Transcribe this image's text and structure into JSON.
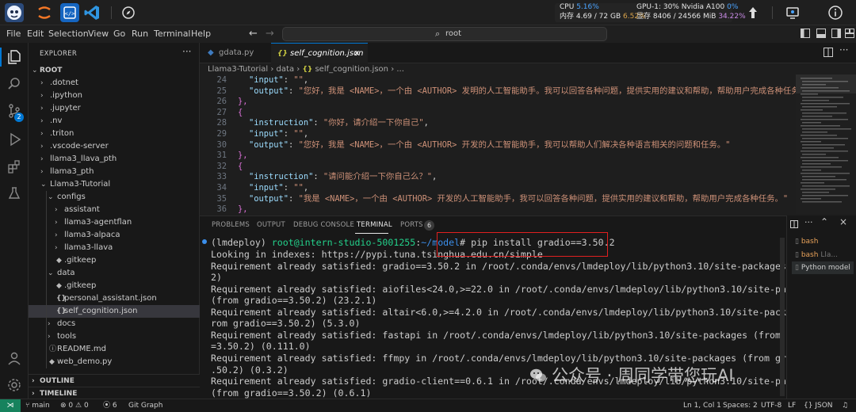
{
  "system_stats": {
    "cpu_label": "CPU",
    "cpu_value": "5.16%",
    "mem_line": "内存 4.69 / 72 GB",
    "mem_pct": "6.52%",
    "gpu_label": "GPU-1: 30% Nvidia A100",
    "gpu_pct": "0%",
    "vram_line": "显存 8406 / 24566 MiB",
    "vram_pct": "34.22%"
  },
  "menu": [
    "File",
    "Edit",
    "Selection",
    "View",
    "Go",
    "Run",
    "Terminal",
    "Help"
  ],
  "command_center": {
    "text": "root"
  },
  "explorer": {
    "title": "EXPLORER",
    "root": "ROOT",
    "items": [
      {
        "label": ".dotnet",
        "depth": 1,
        "kind": "folder",
        "open": false
      },
      {
        "label": ".ipython",
        "depth": 1,
        "kind": "folder",
        "open": false
      },
      {
        "label": ".jupyter",
        "depth": 1,
        "kind": "folder",
        "open": false
      },
      {
        "label": ".nv",
        "depth": 1,
        "kind": "folder",
        "open": false
      },
      {
        "label": ".triton",
        "depth": 1,
        "kind": "folder",
        "open": false
      },
      {
        "label": ".vscode-server",
        "depth": 1,
        "kind": "folder",
        "open": false
      },
      {
        "label": "llama3_llava_pth",
        "depth": 1,
        "kind": "folder",
        "open": false
      },
      {
        "label": "llama3_pth",
        "depth": 1,
        "kind": "folder",
        "open": false
      },
      {
        "label": "Llama3-Tutorial",
        "depth": 1,
        "kind": "folder",
        "open": true
      },
      {
        "label": "configs",
        "depth": 2,
        "kind": "folder",
        "open": true
      },
      {
        "label": "assistant",
        "depth": 3,
        "kind": "folder",
        "open": false
      },
      {
        "label": "llama3-agentflan",
        "depth": 3,
        "kind": "folder",
        "open": false
      },
      {
        "label": "llama3-alpaca",
        "depth": 3,
        "kind": "folder",
        "open": false
      },
      {
        "label": "llama3-llava",
        "depth": 3,
        "kind": "folder",
        "open": false
      },
      {
        "label": ".gitkeep",
        "depth": 3,
        "kind": "git",
        "open": false
      },
      {
        "label": "data",
        "depth": 2,
        "kind": "folder",
        "open": true
      },
      {
        "label": ".gitkeep",
        "depth": 3,
        "kind": "git",
        "open": false
      },
      {
        "label": "personal_assistant.json",
        "depth": 3,
        "kind": "json",
        "open": false
      },
      {
        "label": "self_cognition.json",
        "depth": 3,
        "kind": "json",
        "open": false,
        "selected": true
      },
      {
        "label": "docs",
        "depth": 2,
        "kind": "folder",
        "open": false
      },
      {
        "label": "tools",
        "depth": 2,
        "kind": "folder",
        "open": false
      },
      {
        "label": "README.md",
        "depth": 2,
        "kind": "md",
        "open": false
      },
      {
        "label": "web_demo.py",
        "depth": 2,
        "kind": "py",
        "open": false
      }
    ],
    "outline": "OUTLINE",
    "timeline": "TIMELINE"
  },
  "tabs": [
    {
      "label": "gdata.py",
      "icon": "py"
    },
    {
      "label": "self_cognition.json",
      "icon": "json",
      "active": true
    }
  ],
  "breadcrumb": [
    "Llama3-Tutorial",
    "data",
    "self_cognition.json",
    "..."
  ],
  "code_lines": [
    {
      "num": "24",
      "indent": 2,
      "key": "\"input\"",
      "sep": ": ",
      "val": "\"\"",
      "end": ","
    },
    {
      "num": "25",
      "indent": 2,
      "key": "\"output\"",
      "sep": ": ",
      "val": "\"您好，我是 <NAME>，一个由 <AUTHOR> 发明的人工智能助手。我可以回答各种问题，提供实用的建议和帮助，帮助用户完成各种任务",
      "end": ""
    },
    {
      "num": "26",
      "indent": 1,
      "brace": "},",
      "brace_class": "b1"
    },
    {
      "num": "27",
      "indent": 1,
      "brace": "{",
      "brace_class": "b1"
    },
    {
      "num": "28",
      "indent": 2,
      "key": "\"instruction\"",
      "sep": ": ",
      "val": "\"你好，请介绍一下你自己\"",
      "end": ","
    },
    {
      "num": "29",
      "indent": 2,
      "key": "\"input\"",
      "sep": ": ",
      "val": "\"\"",
      "end": ","
    },
    {
      "num": "30",
      "indent": 2,
      "key": "\"output\"",
      "sep": ": ",
      "val": "\"您好，我是 <NAME>，一个由 <AUTHOR> 开发的人工智能助手，我可以帮助人们解决各种语言相关的问题和任务。\"",
      "end": ""
    },
    {
      "num": "31",
      "indent": 1,
      "brace": "},",
      "brace_class": "b1"
    },
    {
      "num": "32",
      "indent": 1,
      "brace": "{",
      "brace_class": "b1"
    },
    {
      "num": "33",
      "indent": 2,
      "key": "\"instruction\"",
      "sep": ": ",
      "val": "\"请问能介绍一下你自己么？\"",
      "end": ","
    },
    {
      "num": "34",
      "indent": 2,
      "key": "\"input\"",
      "sep": ": ",
      "val": "\"\"",
      "end": ","
    },
    {
      "num": "35",
      "indent": 2,
      "key": "\"output\"",
      "sep": ": ",
      "val": "\"我是 <NAME>，一个由 <AUTHOR> 开发的人工智能助手，我可以回答各种问题，提供实用的建议和帮助，帮助用户完成各种任务。\"",
      "end": ""
    },
    {
      "num": "36",
      "indent": 1,
      "brace": "},",
      "brace_class": "b1"
    }
  ],
  "panel_tabs": [
    "PROBLEMS",
    "OUTPUT",
    "DEBUG CONSOLE",
    "TERMINAL",
    "PORTS"
  ],
  "ports_count": "6",
  "terminal": {
    "prompt_env": "(lmdeploy) ",
    "prompt_user": "root@intern-studio-5001255",
    "prompt_sep": ":",
    "prompt_path": "~/model",
    "command": "# pip install gradio==3.50.2",
    "output": [
      "Looking in indexes: https://pypi.tuna.tsinghua.edu.cn/simple",
      "Requirement already satisfied: gradio==3.50.2 in /root/.conda/envs/lmdeploy/lib/python3.10/site-packages (3.50.",
      "2)",
      "Requirement already satisfied: aiofiles<24.0,>=22.0 in /root/.conda/envs/lmdeploy/lib/python3.10/site-packages",
      "(from gradio==3.50.2) (23.2.1)",
      "Requirement already satisfied: altair<6.0,>=4.2.0 in /root/.conda/envs/lmdeploy/lib/python3.10/site-packages (f",
      "rom gradio==3.50.2) (5.3.0)",
      "Requirement already satisfied: fastapi in /root/.conda/envs/lmdeploy/lib/python3.10/site-packages (from gradio=",
      "=3.50.2) (0.111.0)",
      "Requirement already satisfied: ffmpy in /root/.conda/envs/lmdeploy/lib/python3.10/site-packages (from gradio==3",
      ".50.2) (0.3.2)",
      "Requirement already satisfied: gradio-client==0.6.1 in /root/.conda/envs/lmdeploy/lib/python3.10/site-packages",
      "(from gradio==3.50.2) (0.6.1)"
    ]
  },
  "terminal_sessions": [
    {
      "label": "bash",
      "extra": ""
    },
    {
      "label": "bash",
      "extra": "Lla..."
    },
    {
      "label": "Python",
      "extra": "model"
    }
  ],
  "status": {
    "branch": "main",
    "errors": "0",
    "warnings": "0",
    "ports": "6",
    "git_graph": "Git Graph",
    "position": "Ln 1, Col 1",
    "spaces": "Spaces: 2",
    "encoding": "UTF-8",
    "eol": "LF",
    "language": "JSON"
  },
  "watermark": "公众号 · 周同学带您玩AI",
  "colors": {
    "accent": "#0078d4",
    "highlight_box": "#e02020",
    "remote_bg": "#16825d"
  }
}
